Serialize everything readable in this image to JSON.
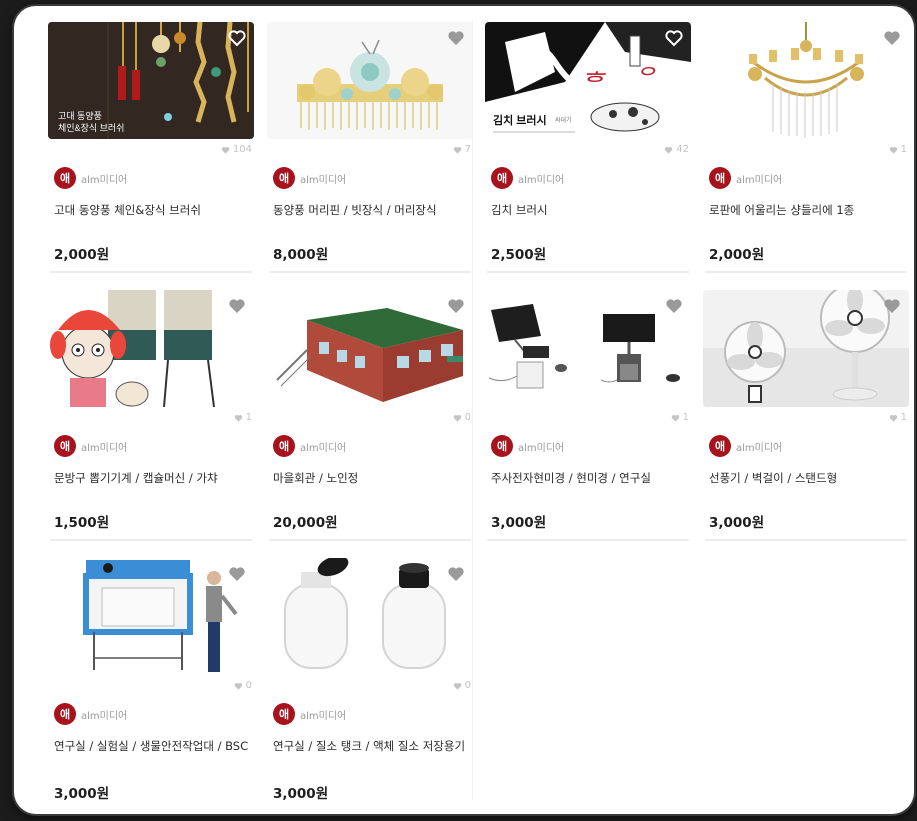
{
  "seller_name": "alm미디어",
  "seller_logo_glyph": "애",
  "products": [
    {
      "title": "고대 동양풍 체인&장식 브러쉬",
      "price": "2,000원",
      "likes": "104",
      "thumb_text_1": "고대 동양풍",
      "thumb_text_2": "체인&장식 브러쉬",
      "thumb_icon": "ornament-image"
    },
    {
      "title": "동양풍 머리핀 / 빗장식 / 머리장식",
      "price": "8,000원",
      "likes": "7",
      "thumb_icon": "hairpin-image"
    },
    {
      "title": "김치 브러시",
      "price": "2,500원",
      "likes": "42",
      "thumb_text_1": "김치 브러시",
      "thumb_text_2": "싸대기",
      "thumb_icon": "kimchi-brush-image"
    },
    {
      "title": "로판에 어울리는 샹들리에 1종",
      "price": "2,000원",
      "likes": "1",
      "thumb_icon": "chandelier-image"
    },
    {
      "title": "문방구 뽑기기계 / 캡슐머신 / 가챠",
      "price": "1,500원",
      "likes": "1",
      "thumb_icon": "capsule-machine-image"
    },
    {
      "title": "마을회관 / 노인정",
      "price": "20,000원",
      "likes": "0",
      "thumb_icon": "village-hall-image"
    },
    {
      "title": "주사전자현미경 / 현미경 / 연구실",
      "price": "3,000원",
      "likes": "1",
      "thumb_icon": "microscope-image"
    },
    {
      "title": "선풍기 / 벽걸이 / 스탠드형",
      "price": "3,000원",
      "likes": "1",
      "thumb_icon": "electric-fan-image"
    },
    {
      "title": "연구실 / 실험실 / 생물안전작업대 / BSC",
      "price": "3,000원",
      "likes": "0",
      "thumb_icon": "biosafety-cabinet-image"
    },
    {
      "title": "연구실 / 질소 탱크 / 액체 질소 저장용기",
      "price": "3,000원",
      "likes": "0",
      "thumb_icon": "nitrogen-tank-image"
    }
  ],
  "colors": {
    "brand": "#a8121d",
    "heart": "#9a9a9a",
    "heart_on_image": "#ffffff"
  }
}
